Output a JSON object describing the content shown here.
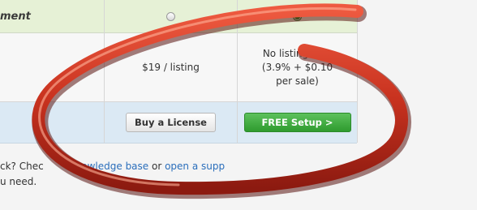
{
  "table": {
    "row1": {
      "label": "ment"
    },
    "row2": {
      "license_price": "$19 / listing",
      "free_line1": "No listing fees",
      "free_line2": "(3.9% + $0.10",
      "free_line3": "per sale)"
    },
    "row3": {
      "license_button": "Buy a License",
      "free_button": "FREE Setup >"
    }
  },
  "help": {
    "prefix": "ck? Chec",
    "link1": "knowledge base",
    "middle": " or ",
    "link2": "open a supp",
    "line2": "u need."
  },
  "colors": {
    "annotation": "#d0392b",
    "annotation_shadow": "#6a1410",
    "free_button": "#3aa53a"
  }
}
